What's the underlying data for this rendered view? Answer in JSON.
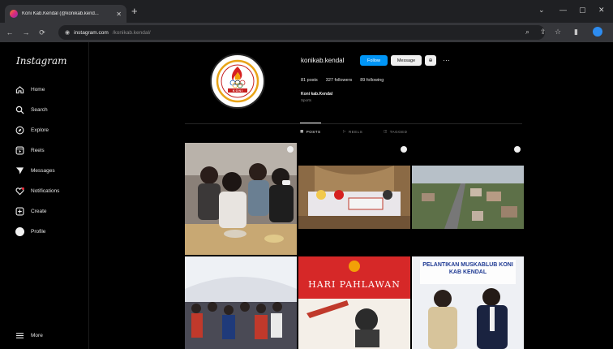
{
  "browser": {
    "tab_title": "Koni Kab.Kendal (@konikab.kend...",
    "tab_close": "✕",
    "new_tab": "+",
    "url_host": "instagram.com",
    "url_path": "/konikab.kendal/",
    "nav": {
      "back": "←",
      "forward": "→",
      "reload": "⟳"
    }
  },
  "sidebar": {
    "logo": "Instagram",
    "items": [
      {
        "label": "Home",
        "icon": "home-icon"
      },
      {
        "label": "Search",
        "icon": "search-icon"
      },
      {
        "label": "Explore",
        "icon": "compass-icon"
      },
      {
        "label": "Reels",
        "icon": "reels-icon"
      },
      {
        "label": "Messages",
        "icon": "send-icon"
      },
      {
        "label": "Notifications",
        "icon": "heart-icon"
      },
      {
        "label": "Create",
        "icon": "plus-square-icon"
      },
      {
        "label": "Profile",
        "icon": "avatar-icon"
      }
    ],
    "more": "More"
  },
  "profile": {
    "username": "konikab.kendal",
    "follow": "Follow",
    "message": "Message",
    "stats": {
      "posts": "81 posts",
      "followers": "327 followers",
      "following": "89 following"
    },
    "name": "Koni kab.Kendal",
    "category": "Sports",
    "logo_text": "K O N I"
  },
  "tabs": [
    {
      "label": "POSTS",
      "active": true
    },
    {
      "label": "REELS",
      "active": false
    },
    {
      "label": "TAGGED",
      "active": false
    }
  ],
  "posts": [
    {
      "caption": ""
    },
    {
      "caption": ""
    },
    {
      "caption": ""
    },
    {
      "caption": ""
    },
    {
      "caption": "HARI PAHLAWAN"
    },
    {
      "caption": "PELANTIKAN MUSKABLUB KONI KAB KENDAL"
    }
  ],
  "colors": {
    "accent": "#0095f6",
    "background": "#000000",
    "chrome_dark": "#1f2023",
    "chrome_toolbar": "#35363a"
  }
}
